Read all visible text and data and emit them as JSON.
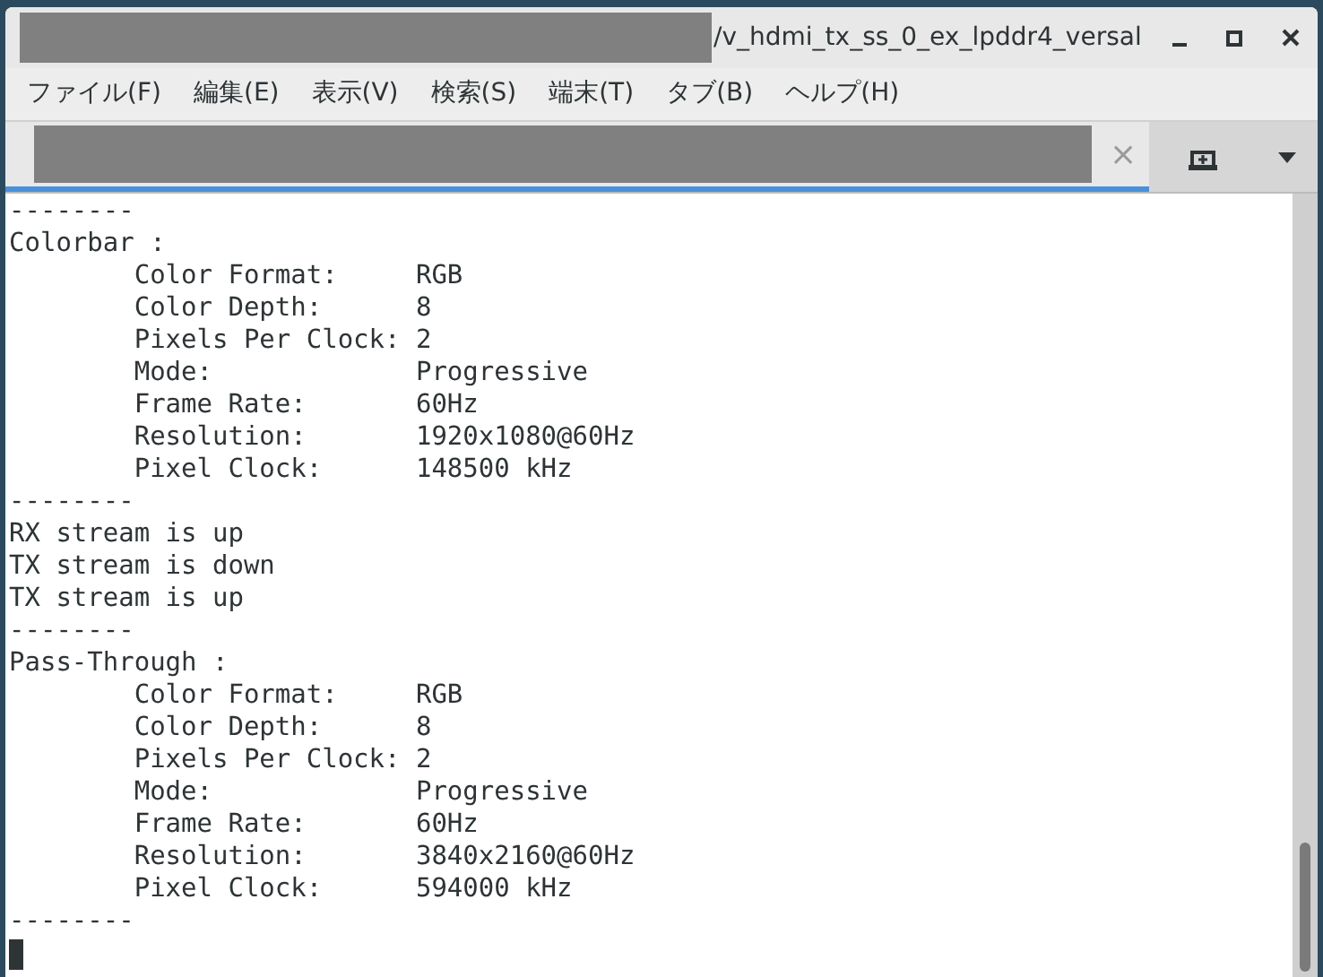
{
  "window": {
    "title": "/v_hdmi_tx_ss_0_ex_lpddr4_versal"
  },
  "menu": [
    "ファイル(F)",
    "編集(E)",
    "表示(V)",
    "検索(S)",
    "端末(T)",
    "タブ(B)",
    "ヘルプ(H)"
  ],
  "tab": {
    "close": "×",
    "selected": true
  },
  "terminal": {
    "lines": [
      "--------",
      "Colorbar :",
      "        Color Format:     RGB",
      "        Color Depth:      8",
      "        Pixels Per Clock: 2",
      "        Mode:             Progressive",
      "        Frame Rate:       60Hz",
      "        Resolution:       1920x1080@60Hz",
      "        Pixel Clock:      148500 kHz",
      "--------",
      "RX stream is up",
      "TX stream is down",
      "TX stream is up",
      "--------",
      "Pass-Through :",
      "        Color Format:     RGB",
      "        Color Depth:      8",
      "        Pixels Per Clock: 2",
      "        Mode:             Progressive",
      "        Frame Rate:       60Hz",
      "        Resolution:       3840x2160@60Hz",
      "        Pixel Clock:      594000 kHz",
      "--------"
    ]
  }
}
